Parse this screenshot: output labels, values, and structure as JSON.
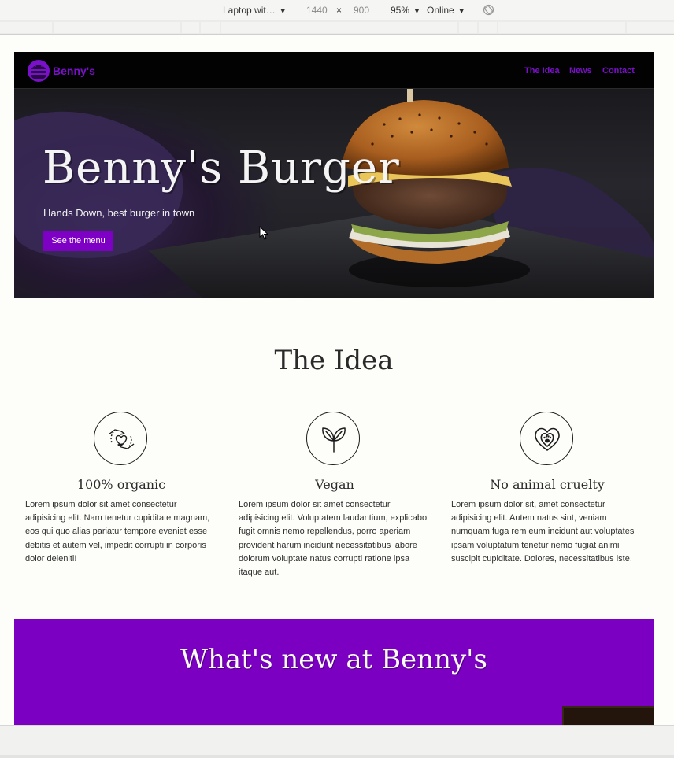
{
  "devtools": {
    "device": "Laptop wit…",
    "width": "1440",
    "times": "×",
    "height": "900",
    "zoom": "95%",
    "network": "Online"
  },
  "nav": {
    "brand": "Benny's",
    "links": [
      "The Idea",
      "News",
      "Contact"
    ]
  },
  "hero": {
    "title": "Benny's Burger",
    "subtitle": "Hands Down, best burger in town",
    "button": "See the menu"
  },
  "idea": {
    "title": "The Idea",
    "features": [
      {
        "icon": "hands-heart-icon",
        "title": "100% organic",
        "text": "Lorem ipsum dolor sit amet consectetur adipisicing elit. Nam tenetur cupiditate magnam, eos qui quo alias pariatur tempore eveniet esse debitis et autem vel, impedit corrupti in corporis dolor deleniti!"
      },
      {
        "icon": "leaf-sprout-icon",
        "title": "Vegan",
        "text": "Lorem ipsum dolor sit amet consectetur adipisicing elit. Voluptatem laudantium, explicabo fugit omnis nemo repellendus, porro aperiam provident harum incidunt necessitatibus labore dolorum voluptate natus corrupti ratione ipsa itaque aut."
      },
      {
        "icon": "heart-paw-icon",
        "title": "No animal cruelty",
        "text": "Lorem ipsum dolor sit, amet consectetur adipisicing elit. Autem natus sint, veniam numquam fuga rem eum incidunt aut voluptates ipsam voluptatum tenetur nemo fugiat animi suscipit cupiditate. Dolores, necessitatibus iste."
      }
    ]
  },
  "news": {
    "title": "What's new at Benny's"
  },
  "colors": {
    "accent": "#7b00c2",
    "nav_bg": "#020202",
    "page_bg": "#fdfdf9"
  }
}
